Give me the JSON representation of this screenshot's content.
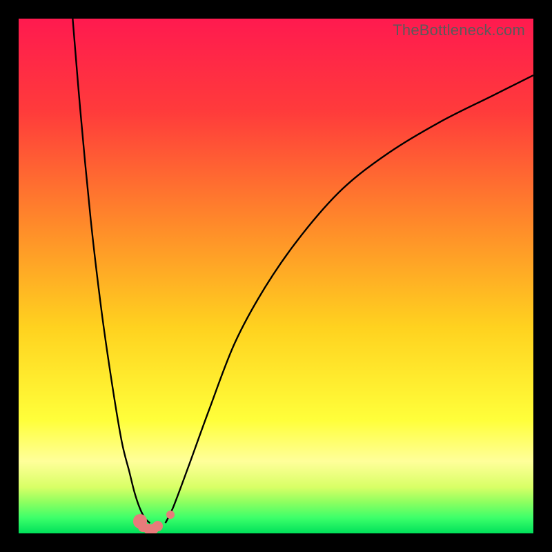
{
  "watermark": "TheBottleneck.com",
  "colors": {
    "frame_bg": "#000000",
    "curve": "#000000",
    "marker": "#e87b7b",
    "gradient_stops": [
      {
        "offset": 0.0,
        "color": "#ff1a4f"
      },
      {
        "offset": 0.18,
        "color": "#ff3b3b"
      },
      {
        "offset": 0.4,
        "color": "#ff8a2a"
      },
      {
        "offset": 0.6,
        "color": "#ffd21f"
      },
      {
        "offset": 0.78,
        "color": "#ffff3a"
      },
      {
        "offset": 0.86,
        "color": "#ffff9a"
      },
      {
        "offset": 0.91,
        "color": "#d9ff66"
      },
      {
        "offset": 0.94,
        "color": "#8cff60"
      },
      {
        "offset": 0.97,
        "color": "#3cff6a"
      },
      {
        "offset": 1.0,
        "color": "#00e05a"
      }
    ]
  },
  "chart_data": {
    "type": "line",
    "title": "",
    "xlabel": "",
    "ylabel": "",
    "xlim": [
      0,
      100
    ],
    "ylim": [
      0,
      100
    ],
    "series": [
      {
        "name": "left-curve",
        "x": [
          10.5,
          12,
          14,
          16,
          18,
          20,
          21.5,
          22.5,
          23.5,
          24.5,
          25.5
        ],
        "y": [
          100,
          82,
          61,
          44,
          30,
          18,
          12,
          8,
          5,
          3,
          2
        ]
      },
      {
        "name": "right-curve",
        "x": [
          28.5,
          30,
          33,
          37,
          42,
          48,
          55,
          63,
          72,
          82,
          92,
          100
        ],
        "y": [
          2,
          5,
          13,
          24,
          37,
          48,
          58,
          67,
          74,
          80,
          85,
          89
        ]
      }
    ],
    "markers": [
      {
        "name": "valley-left-1",
        "x": 23.6,
        "y": 2.4,
        "size": 2.8
      },
      {
        "name": "valley-left-2",
        "x": 24.2,
        "y": 1.2,
        "size": 2.0
      },
      {
        "name": "valley-left-3",
        "x": 25.2,
        "y": 0.85,
        "size": 2.0
      },
      {
        "name": "valley-left-4",
        "x": 26.2,
        "y": 0.85,
        "size": 2.0
      },
      {
        "name": "valley-left-5",
        "x": 27.0,
        "y": 1.4,
        "size": 2.0
      },
      {
        "name": "valley-right-1",
        "x": 29.5,
        "y": 3.6,
        "size": 1.6
      }
    ]
  }
}
